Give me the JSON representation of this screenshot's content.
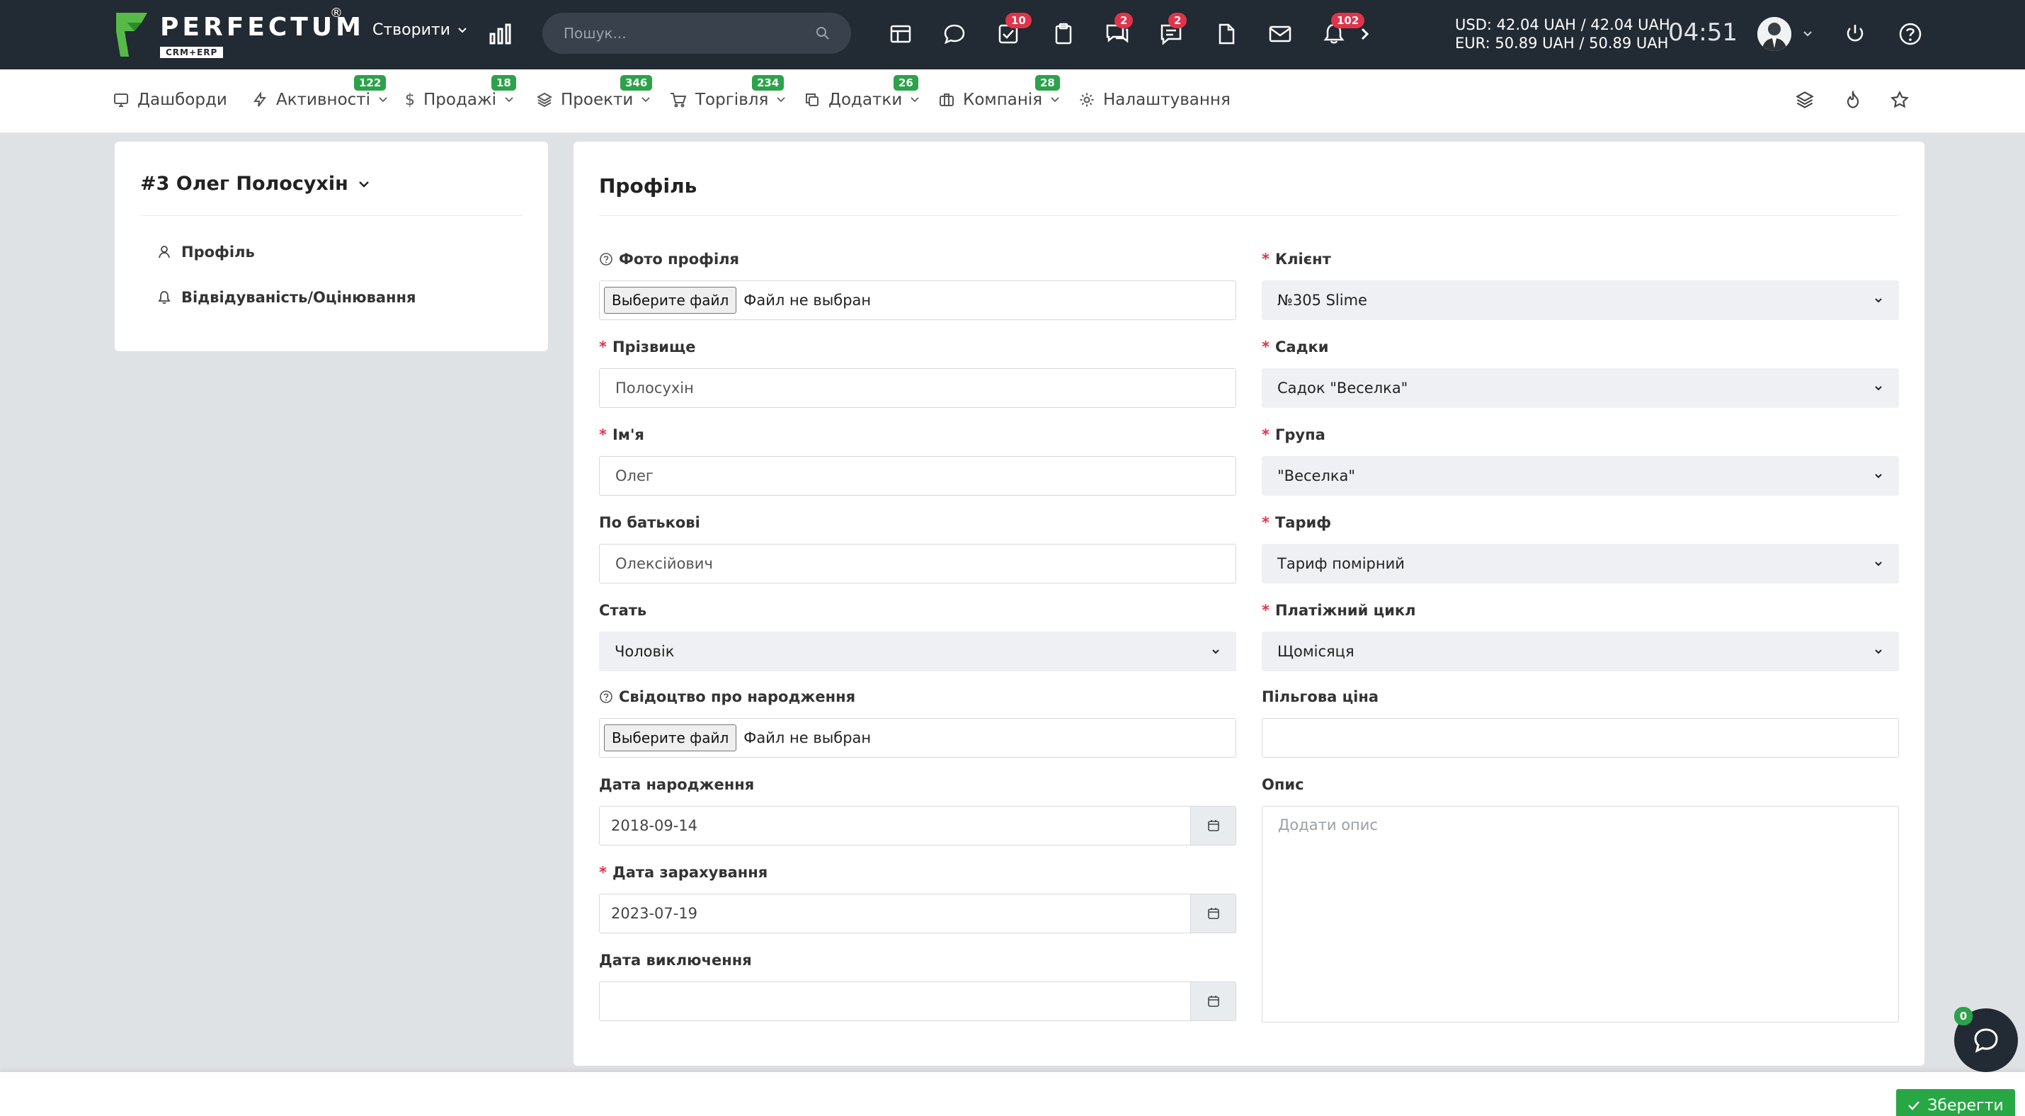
{
  "topbar": {
    "logo_text": "PERFECTUM",
    "logo_sub": "CRM+ERP",
    "logo_reg": "®",
    "create_label": "Створити",
    "search_placeholder": "Пошук...",
    "badges": {
      "tasks": "10",
      "chats": "2",
      "messages": "2",
      "notifications": "102"
    },
    "rates": {
      "usd": "USD: 42.04 UAH / 42.04 UAH",
      "eur": "EUR: 50.89 UAH / 50.89 UAH"
    },
    "clock": "04:51",
    "colors": {
      "bg": "#222a33",
      "badge": "#e0344a",
      "accent": "#2ca24a"
    }
  },
  "nav": {
    "items": [
      {
        "label": "Дашборди",
        "icon": "monitor-icon"
      },
      {
        "label": "Активності",
        "icon": "bolt-icon",
        "badge": "122"
      },
      {
        "label": "Продажі",
        "icon": "dollar-icon",
        "badge": "18"
      },
      {
        "label": "Проекти",
        "icon": "layers-icon",
        "badge": "346"
      },
      {
        "label": "Торгівля",
        "icon": "cart-icon",
        "badge": "234"
      },
      {
        "label": "Додатки",
        "icon": "copy-icon",
        "badge": "26"
      },
      {
        "label": "Компанія",
        "icon": "briefcase-icon",
        "badge": "28"
      },
      {
        "label": "Налаштування",
        "icon": "gear-icon"
      }
    ]
  },
  "sidebar": {
    "title": "#3 Олег Полосухін",
    "items": [
      {
        "label": "Профіль",
        "icon": "user-icon"
      },
      {
        "label": "Відвідуваність/Оцінювання",
        "icon": "bell-icon"
      }
    ]
  },
  "form": {
    "title": "Профіль",
    "photo": {
      "label": "Фото профіля",
      "button": "Выберите файл",
      "status": "Файл не выбран"
    },
    "surname": {
      "label": "Прізвище",
      "value": "Полосухін"
    },
    "name": {
      "label": "Ім'я",
      "value": "Олег"
    },
    "patronymic": {
      "label": "По батькові",
      "value": "Олексійович"
    },
    "gender": {
      "label": "Стать",
      "value": "Чоловік"
    },
    "birth_cert": {
      "label": "Свідоцтво про народження",
      "button": "Выберите файл",
      "status": "Файл не выбран"
    },
    "birth_date": {
      "label": "Дата народження",
      "value": "2018-09-14"
    },
    "enroll_date": {
      "label": "Дата зарахування",
      "value": "2023-07-19"
    },
    "exclude_date": {
      "label": "Дата виключення",
      "value": ""
    },
    "client": {
      "label": "Клієнт",
      "value": "№305 Slime"
    },
    "kindergarten": {
      "label": "Садки",
      "value": "Садок \"Веселка\""
    },
    "group": {
      "label": "Група",
      "value": "\"Веселка\""
    },
    "tariff": {
      "label": "Тариф",
      "value": "Тариф помірний"
    },
    "payment_cycle": {
      "label": "Платіжний цикл",
      "value": "Щомісяця"
    },
    "discount_price": {
      "label": "Пільгова ціна",
      "value": ""
    },
    "description": {
      "label": "Опис",
      "placeholder": "Додати опис"
    }
  },
  "footer": {
    "save_label": "Зберегти",
    "chat_badge": "0"
  }
}
